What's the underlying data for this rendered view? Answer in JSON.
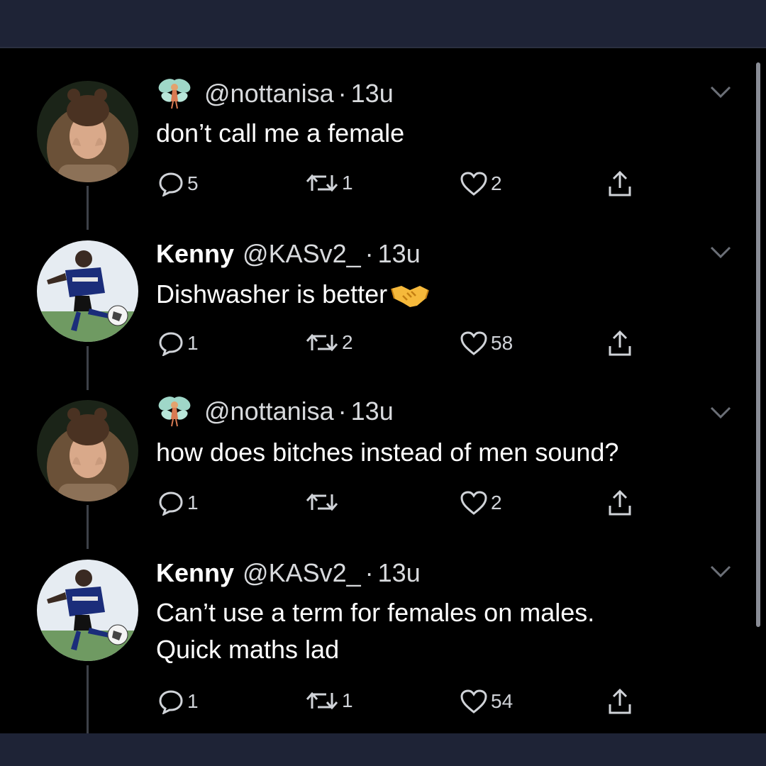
{
  "tweets": [
    {
      "display_name": "",
      "handle": "@nottanisa",
      "time": "13u",
      "text_lines": [
        "don’t call me a female"
      ],
      "has_fairy_emoji": true,
      "has_handshake_emoji": false,
      "avatar": "woman-portrait",
      "replies": "5",
      "retweets": "1",
      "likes": "2"
    },
    {
      "display_name": "Kenny",
      "handle": "@KASv2_",
      "time": "13u",
      "text_lines": [
        "Dishwasher is better"
      ],
      "has_fairy_emoji": false,
      "has_handshake_emoji": true,
      "avatar": "footballer-photo",
      "replies": "1",
      "retweets": "2",
      "likes": "58"
    },
    {
      "display_name": "",
      "handle": "@nottanisa",
      "time": "13u",
      "text_lines": [
        "how does bitches instead of men sound?"
      ],
      "has_fairy_emoji": true,
      "has_handshake_emoji": false,
      "avatar": "woman-portrait",
      "replies": "1",
      "retweets": "",
      "likes": "2"
    },
    {
      "display_name": "Kenny",
      "handle": "@KASv2_",
      "time": "13u",
      "text_lines": [
        "Can’t use a term for females on males.",
        "Quick maths lad"
      ],
      "has_fairy_emoji": false,
      "has_handshake_emoji": false,
      "avatar": "footballer-photo",
      "replies": "1",
      "retweets": "1",
      "likes": "54"
    }
  ],
  "icons": {
    "reply": "speech-bubble-icon",
    "retweet": "retweet-arrows-icon",
    "like": "heart-outline-icon",
    "share": "share-upload-icon",
    "menu": "chevron-down-icon"
  },
  "colors": {
    "background": "#000000",
    "frame": "#1e2336",
    "text": "#ffffff",
    "muted": "#d0d3d8"
  }
}
